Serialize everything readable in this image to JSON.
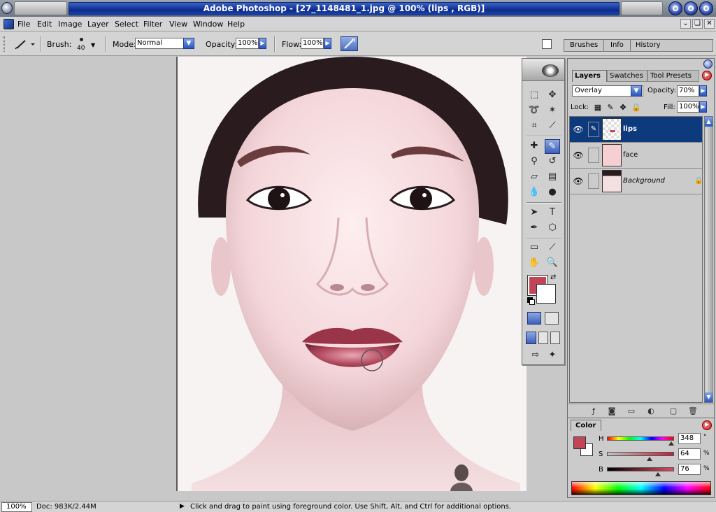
{
  "window": {
    "title": "Adobe Photoshop - [27_1148481_1.jpg @ 100% (lips , RGB)]",
    "controls": [
      "minimize",
      "maximize",
      "close"
    ]
  },
  "menubar": {
    "items": [
      "File",
      "Edit",
      "Image",
      "Layer",
      "Select",
      "Filter",
      "View",
      "Window",
      "Help"
    ],
    "doc_controls": [
      "⌄",
      "❏",
      "✕"
    ]
  },
  "options": {
    "brush_label": "Brush:",
    "brush_size": "40",
    "mode_label": "Mode:",
    "mode_value": "Normal",
    "opacity_label": "Opacity:",
    "opacity_value": "100%",
    "flow_label": "Flow:",
    "flow_value": "100%"
  },
  "palette_well": {
    "tabs": [
      "Brushes",
      "Info",
      "History"
    ]
  },
  "layers_palette": {
    "tabs": [
      "Layers",
      "Swatches",
      "Tool Presets"
    ],
    "blend_mode": "Overlay",
    "opacity_label": "Opacity:",
    "opacity_value": "70%",
    "lock_label": "Lock:",
    "fill_label": "Fill:",
    "fill_value": "100%",
    "layers": [
      {
        "name": "lips",
        "selected": true,
        "linked": "brush"
      },
      {
        "name": "face",
        "selected": false,
        "linked": ""
      },
      {
        "name": "Background",
        "selected": false,
        "linked": "",
        "locked": true
      }
    ]
  },
  "color_palette": {
    "tab": "Color",
    "h_label": "H",
    "h_value": "348",
    "h_unit": "°",
    "s_label": "S",
    "s_value": "64",
    "s_unit": "%",
    "b_label": "B",
    "b_value": "76",
    "b_unit": "%",
    "foreground": "#c24457",
    "background": "#ffffff"
  },
  "status": {
    "zoom": "100%",
    "doc_size": "Doc: 983K/2.44M",
    "message": "Click and drag to paint using foreground color.  Use Shift, Alt, and Ctrl for additional options."
  },
  "colors": {
    "accent": "#0d3a7d",
    "title_bar": "#0b2a8e",
    "foreground": "#c24457"
  }
}
